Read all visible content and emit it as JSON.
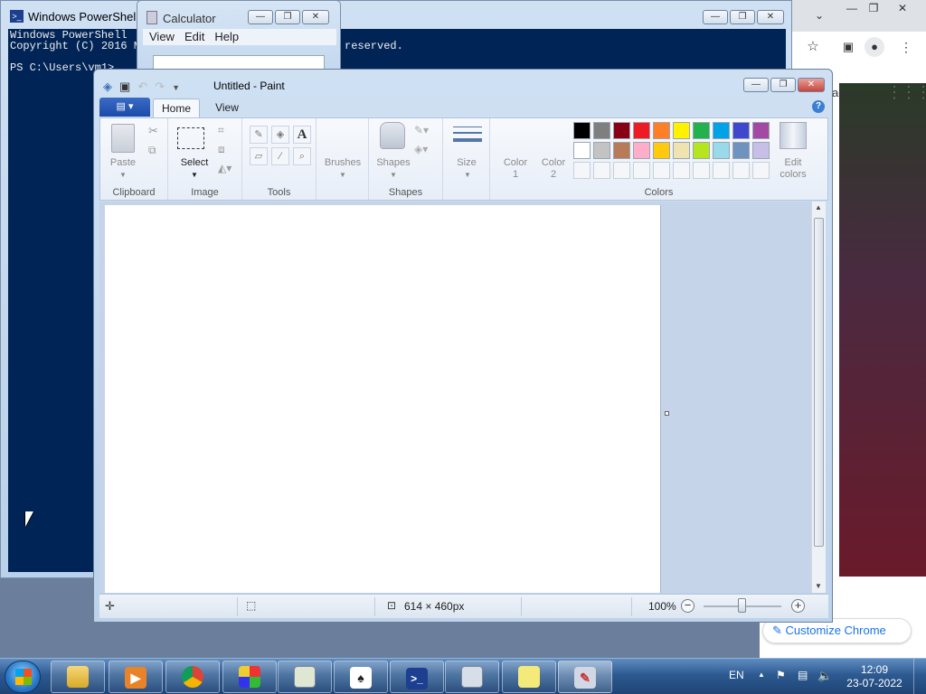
{
  "chrome": {
    "images_label": "ages",
    "customize_label": "Customize Chrome"
  },
  "powershell": {
    "title": "Windows PowerShell",
    "console_lines": [
      "Windows PowerShell",
      "Copyright (C) 2016 M",
      "",
      "PS C:\\Users\\vm1>"
    ],
    "console_right": "reserved."
  },
  "calculator": {
    "title": "Calculator",
    "menu": [
      "View",
      "Edit",
      "Help"
    ]
  },
  "paint": {
    "title": "Untitled - Paint",
    "tabs": {
      "home": "Home",
      "view": "View"
    },
    "groups": {
      "clipboard": "Clipboard",
      "image": "Image",
      "tools": "Tools",
      "shapes": "Shapes",
      "colors": "Colors"
    },
    "buttons": {
      "paste": "Paste",
      "select": "Select",
      "brushes": "Brushes",
      "shapes": "Shapes",
      "size": "Size",
      "color1": "Color\n1",
      "color2": "Color\n2",
      "edit_colors": "Edit\ncolors"
    },
    "palette_row1": [
      "#000000",
      "#7f7f7f",
      "#880015",
      "#ed1c24",
      "#ff7f27",
      "#fff200",
      "#22b14c",
      "#00a2e8",
      "#3f48cc",
      "#a349a4"
    ],
    "palette_row2": [
      "#ffffff",
      "#c3c3c3",
      "#b97a57",
      "#ffaec9",
      "#ffc90e",
      "#efe4b0",
      "#b5e61d",
      "#99d9ea",
      "#7092be",
      "#c8bfe7"
    ],
    "status": {
      "dimensions": "614 × 460px",
      "zoom": "100%"
    }
  },
  "taskbar": {
    "lang": "EN",
    "time": "12:09",
    "date": "23-07-2022"
  }
}
